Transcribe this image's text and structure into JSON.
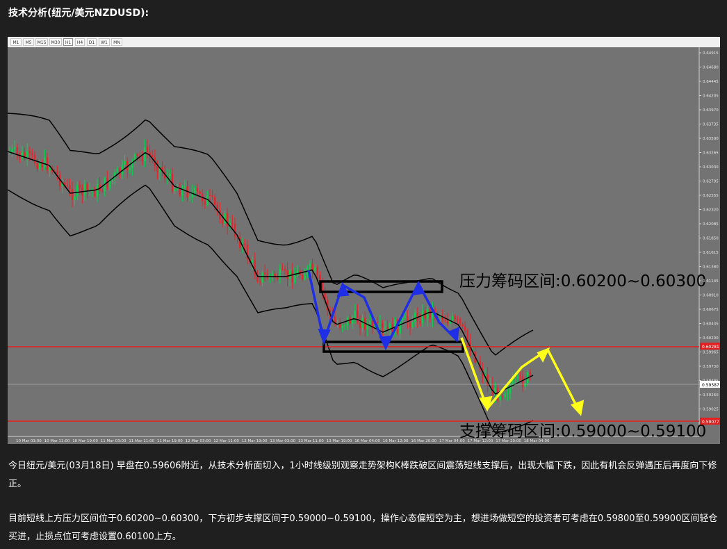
{
  "heading": "技术分析(纽元/美元NZDUSD):",
  "timeframes": [
    "M1",
    "M5",
    "M15",
    "M30",
    "H1",
    "H4",
    "D1",
    "W1",
    "MN"
  ],
  "active_timeframe": "H1",
  "chart": {
    "price_labels": [
      "0.64915",
      "0.64680",
      "0.64445",
      "0.64205",
      "0.63970",
      "0.63735",
      "0.63500",
      "0.63265",
      "0.63030",
      "0.62795",
      "0.62555",
      "0.62320",
      "0.62085",
      "0.61850",
      "0.61615",
      "0.61380",
      "0.61145",
      "0.60910",
      "0.60675",
      "0.60435",
      "0.60200",
      "0.59965",
      "0.59730",
      "0.59495",
      "0.59260",
      "0.59025",
      "0.58785"
    ],
    "time_labels": [
      "10 Mar 03:00",
      "10 Mar 11:00",
      "10 Mar 19:00",
      "11 Mar 03:00",
      "11 Mar 11:00",
      "11 Mar 19:00",
      "12 Mar 03:00",
      "12 Mar 11:00",
      "12 Mar 19:00",
      "13 Mar 03:00",
      "13 Mar 11:00",
      "13 Mar 19:00",
      "16 Mar 04:00",
      "16 Mar 12:00",
      "16 Mar 20:00",
      "17 Mar 04:00",
      "17 Mar 12:00",
      "17 Mar 20:00",
      "18 Mar 04:00"
    ],
    "resistance_line_label": "0.60281",
    "support_line_label": "0.59077",
    "current_price_label": "0.59587",
    "resistance_text": "压力筹码区间:0.60200~0.60300",
    "support_text": "支撑筹码区间:0.59000~0.59100",
    "colors": {
      "background": "#737373",
      "bull_candle": "#00d84a",
      "bear_candle": "#e8232a",
      "bollinger": "#000000",
      "level_line": "#e51f1f",
      "zigzag_blue": "#1e2fe6",
      "forecast_yellow": "#ffff1a"
    }
  },
  "paragraphs": [
    "今日纽元/美元(03月18日) 早盘在0.59606附近，从技术分析面切入，1小时线级别观察走势架构K棒跌破区间震荡短线支撑后，出现大幅下跌，因此有机会反弹遇压后再度向下修正。",
    "目前短线上方压力区间位于0.60200~0.60300，下方初步支撑区间于0.59000~0.59100，操作心态偏短空为主，想进场做短空的投资者可考虑在0.59800至0.59900区间轻仓买进，止损点位可考虑设置0.60100上方。"
  ]
}
